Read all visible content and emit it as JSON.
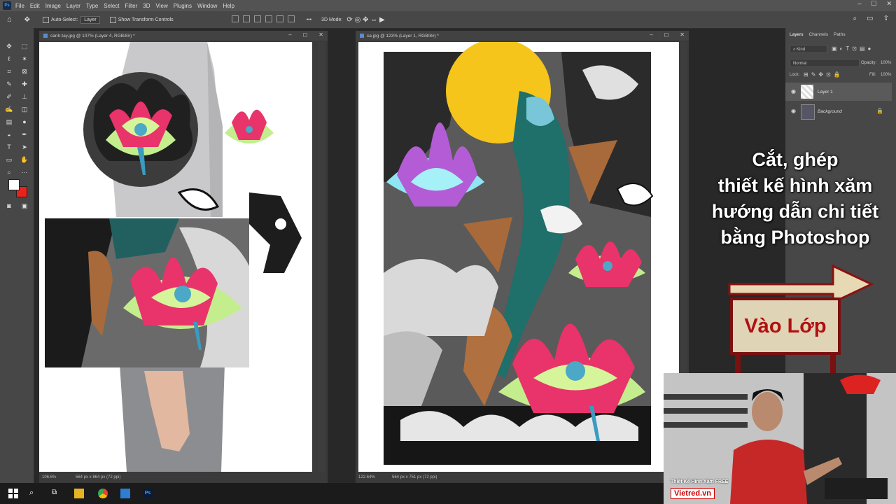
{
  "menubar": {
    "app_icon": "Ps",
    "items": [
      "File",
      "Edit",
      "Image",
      "Layer",
      "Type",
      "Select",
      "Filter",
      "3D",
      "View",
      "Plugins",
      "Window",
      "Help"
    ],
    "window_controls": [
      "–",
      "☐",
      "✕"
    ]
  },
  "options_bar": {
    "auto_select_label": "Auto-Select:",
    "auto_select_value": "Layer",
    "show_transform_label": "Show Transform Controls",
    "mode_3d_label": "3D Mode:",
    "more": "•••"
  },
  "documents": [
    {
      "tab_title": "canh-tay.jpg @ 107% (Layer 4, RGB/8#) *",
      "zoom": "106.6%",
      "doc_size": "564 px x 864 px (72 ppi)"
    },
    {
      "tab_title": "ca.jpg @ 123% (Layer 1, RGB/8#) *",
      "zoom": "122.64%",
      "doc_size": "564 px x 751 px (72 ppi)"
    }
  ],
  "layers_panel": {
    "tabs": [
      "Layers",
      "Channels",
      "Paths"
    ],
    "filter_label": "Kind",
    "blend_mode": "Normal",
    "opacity_label": "Opacity:",
    "opacity_value": "100%",
    "lock_label": "Lock:",
    "fill_label": "Fill:",
    "fill_value": "100%",
    "layers": [
      {
        "name": "Layer 1"
      },
      {
        "name": "Background"
      }
    ]
  },
  "overlay": {
    "title_lines": [
      "Cắt, ghép",
      "thiết kế hình xăm",
      "hướng  dẫn chi tiết",
      "bằng Photoshop"
    ],
    "sign_text": "Vào Lớp",
    "sign_color": "#b01010",
    "brand_caption": "Thiết Kế Hình Xăm FREE",
    "brand_logo": "Vietred.vn"
  },
  "colors": {
    "foreground": "#ffffff",
    "background": "#e8231b",
    "app_bg": "#282828",
    "panel_bg": "#474747"
  }
}
